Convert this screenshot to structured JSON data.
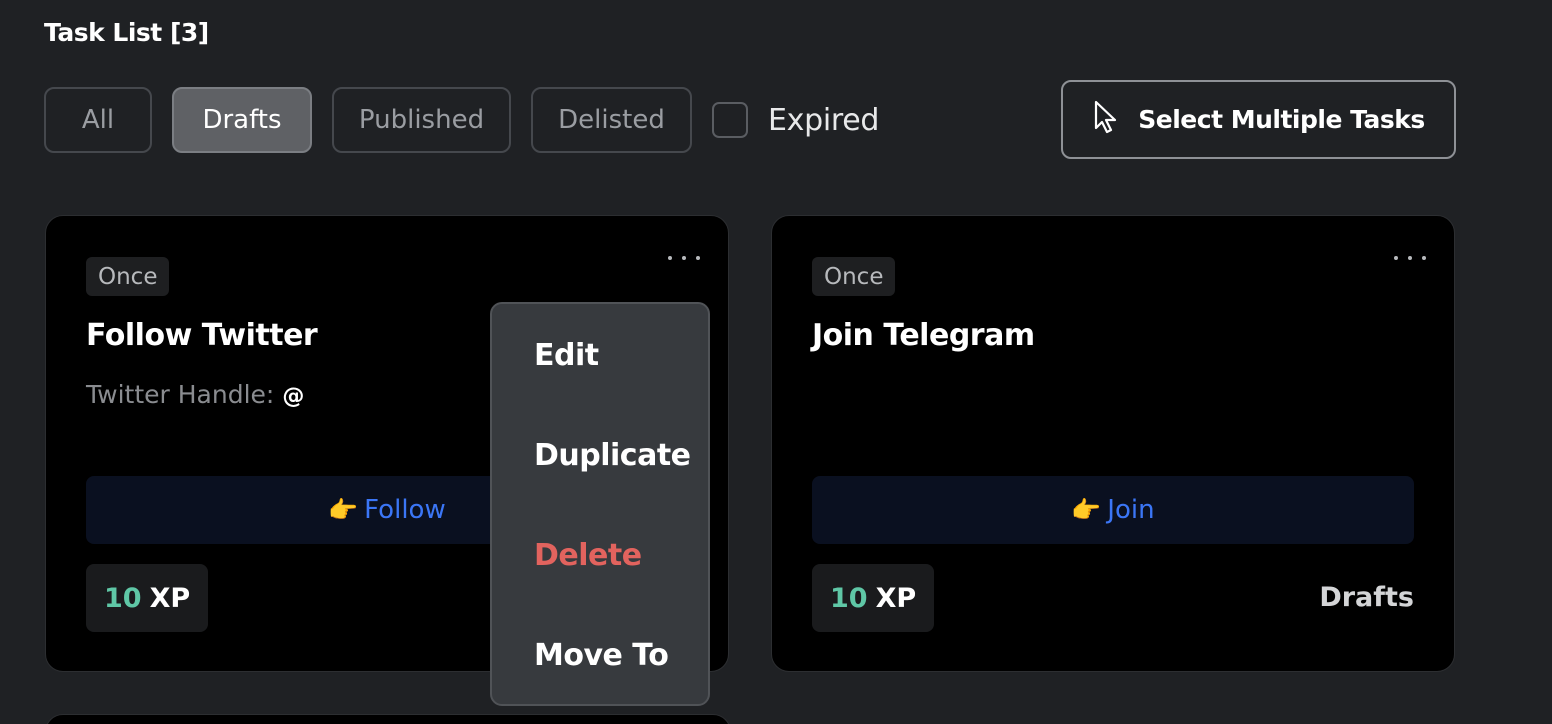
{
  "header": {
    "title": "Task List [3]"
  },
  "filters": {
    "tabs": [
      "All",
      "Drafts",
      "Published",
      "Delisted"
    ],
    "active": "Drafts",
    "expired_label": "Expired",
    "expired_checked": false
  },
  "toolbar": {
    "select_multiple_label": "Select Multiple Tasks",
    "select_multiple_icon": "cursor-arrow-icon"
  },
  "cards": [
    {
      "frequency": "Once",
      "title": "Follow Twitter",
      "detail_label": "Twitter Handle:",
      "detail_value": "@",
      "action_icon": "pointing-hand-icon",
      "action_emoji": "👉",
      "action_label": "Follow",
      "xp_value": "10",
      "xp_unit": "XP"
    },
    {
      "frequency": "Once",
      "title": "Join Telegram",
      "action_icon": "pointing-hand-icon",
      "action_emoji": "👉",
      "action_label": "Join",
      "xp_value": "10",
      "xp_unit": "XP",
      "status": "Drafts"
    }
  ],
  "context_menu": {
    "items": [
      "Edit",
      "Duplicate",
      "Delete",
      "Move To"
    ]
  },
  "colors": {
    "background": "#1f2124",
    "card": "#000000",
    "accent_blue": "#3b76f6",
    "xp_green": "#5fc7a6",
    "danger_red": "#e2635e"
  }
}
